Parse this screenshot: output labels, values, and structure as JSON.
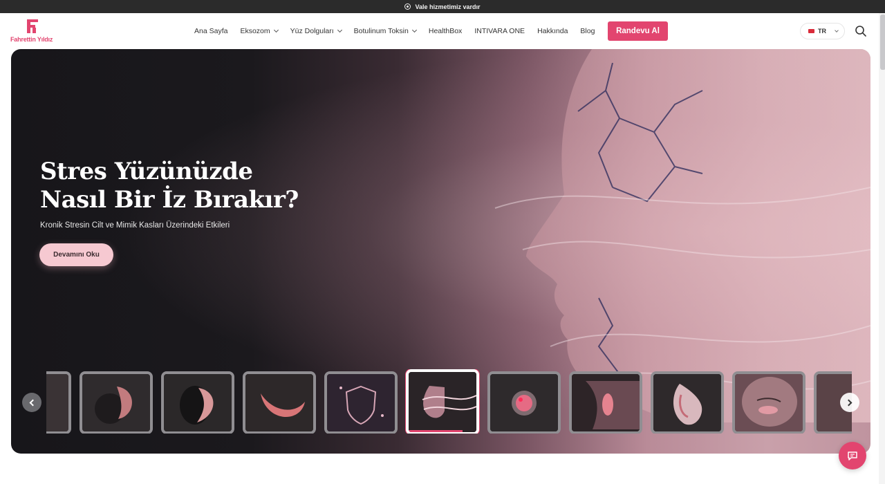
{
  "topbar": {
    "text": "Vale hizmetimiz vardır",
    "icon": "parking-pin-icon"
  },
  "brand": {
    "name": "Fahrettin Yıldız",
    "color": "#e2456f"
  },
  "nav": {
    "items": [
      {
        "label": "Ana Sayfa",
        "dropdown": false
      },
      {
        "label": "Eksozom",
        "dropdown": true
      },
      {
        "label": "Yüz Dolguları",
        "dropdown": true
      },
      {
        "label": "Botulinum Toksin",
        "dropdown": true
      },
      {
        "label": "HealthBox",
        "dropdown": false
      },
      {
        "label": "INTIVARA ONE",
        "dropdown": false
      },
      {
        "label": "Hakkında",
        "dropdown": false
      },
      {
        "label": "Blog",
        "dropdown": false
      }
    ],
    "cta": "Randevu Al"
  },
  "language": {
    "current": "TR",
    "icon": "turkey-flag-icon"
  },
  "hero": {
    "title_line1": "Stres Yüzünüzde",
    "title_line2": "Nasıl Bir İz Bırakır?",
    "subtitle": "Kronik Stresin Cilt ve Mimik Kasları Üzerindeki Etkileri",
    "button": "Devamını Oku"
  },
  "slider": {
    "active_index": 5,
    "thumbnails": [
      "partial-thumbnail",
      "dark-organic-sculpture",
      "black-pink-sculpture",
      "pink-crescent",
      "shield-particles",
      "face-wave-stress",
      "pink-cell",
      "silhouette-profile",
      "implant-shape",
      "face-eye-patch",
      "partial-thumbnail"
    ]
  },
  "colors": {
    "accent": "#e2456f",
    "hero_button": "#f6c9d1",
    "topbar": "#2b2b2b"
  }
}
